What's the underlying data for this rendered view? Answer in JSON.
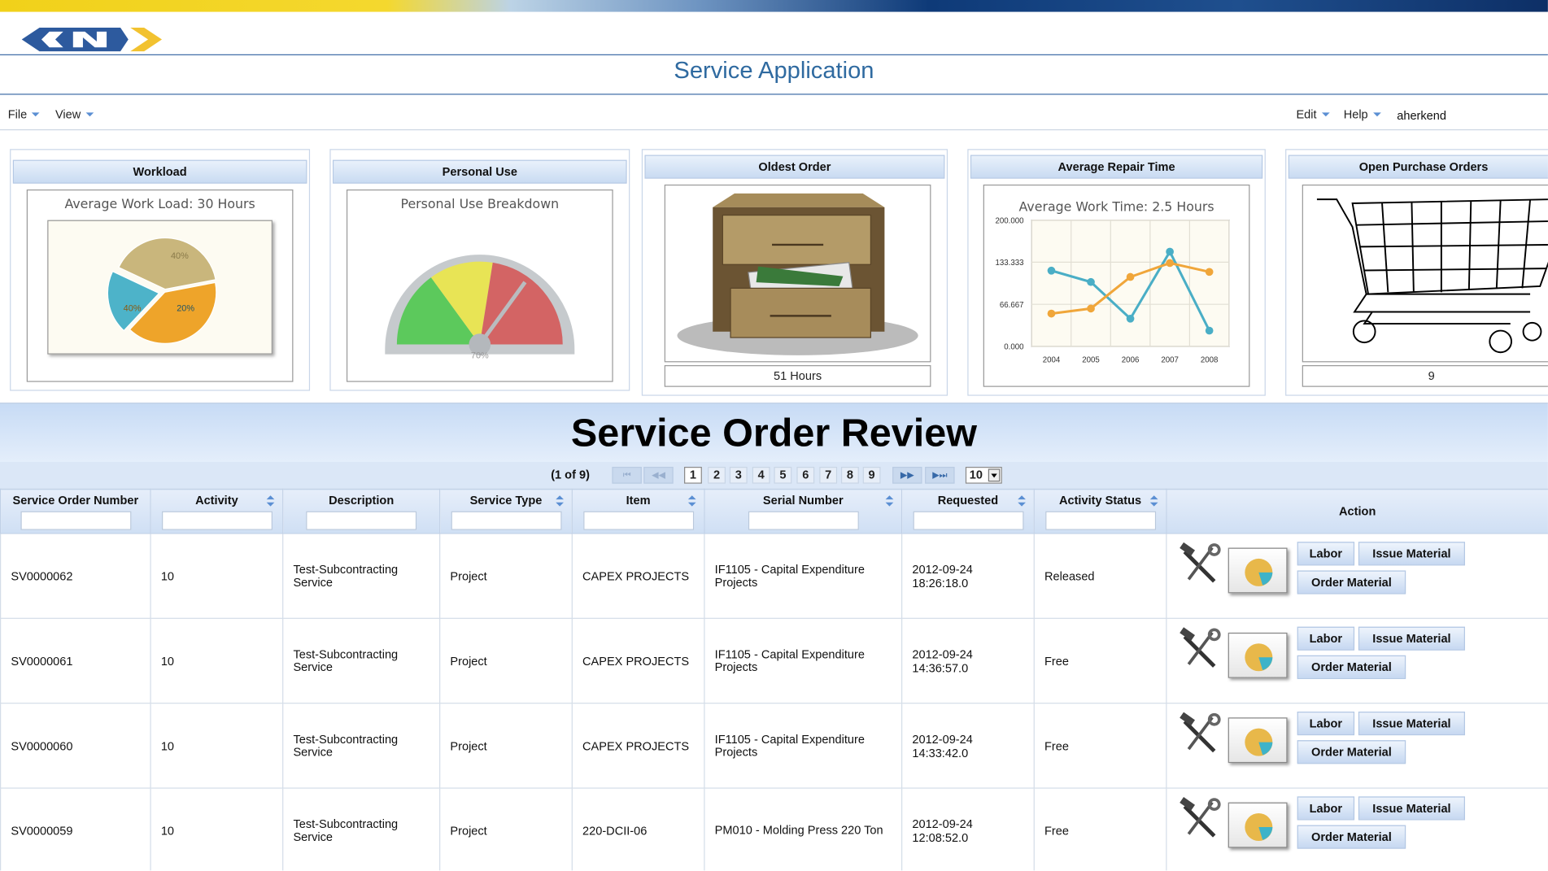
{
  "header": {
    "app_title": "Service Application",
    "logo": "GKN"
  },
  "menubar": {
    "file": "File",
    "view": "View",
    "edit": "Edit",
    "help": "Help",
    "user": "aherkend"
  },
  "widgets": {
    "workload": {
      "title": "Workload",
      "chart_title": "Average Work Load: 30 Hours",
      "labels": [
        "40%",
        "40%",
        "20%"
      ]
    },
    "personal_use": {
      "title": "Personal Use",
      "chart_title": "Personal Use Breakdown",
      "gauge_label": "70%"
    },
    "oldest_order": {
      "title": "Oldest Order",
      "footer": "51 Hours"
    },
    "avg_repair": {
      "title": "Average Repair Time",
      "chart_title": "Average Work Time: 2.5 Hours"
    },
    "open_po": {
      "title": "Open Purchase Orders",
      "footer": "9"
    }
  },
  "chart_data": [
    {
      "type": "pie",
      "title": "Average Work Load: 30 Hours",
      "categories": [
        "",
        "",
        ""
      ],
      "values": [
        40,
        40,
        20
      ],
      "labels": [
        "40%",
        "40%",
        "20%"
      ],
      "colors": [
        "#c9b67c",
        "#eea42a",
        "#4db3c9"
      ]
    },
    {
      "type": "gauge",
      "title": "Personal Use Breakdown",
      "value": 70,
      "range": [
        0,
        100
      ],
      "label": "70%",
      "bands": [
        "#5cc95c",
        "#e8e455",
        "#d36464"
      ]
    },
    {
      "type": "line",
      "title": "Average Work Time: 2.5 Hours",
      "x": [
        "2004",
        "2005",
        "2006",
        "2007",
        "2008"
      ],
      "yticks": [
        "0.000",
        "66.667",
        "133.333",
        "200.000"
      ],
      "ylim": [
        0,
        200
      ],
      "series": [
        {
          "color": "#4aaec6",
          "values": [
            120,
            102,
            44,
            150,
            25
          ]
        },
        {
          "color": "#f0a63a",
          "values": [
            52,
            60,
            110,
            132,
            118
          ]
        }
      ]
    }
  ],
  "banner": {
    "title": "Service Order Review"
  },
  "paginator": {
    "info": "(1 of 9)",
    "pages": [
      "1",
      "2",
      "3",
      "4",
      "5",
      "6",
      "7",
      "8",
      "9"
    ],
    "first": "⏮",
    "prev": "◀◀",
    "next": "▶▶",
    "last": "▶⏭",
    "rows_per_page": "10"
  },
  "table": {
    "columns": [
      "Service Order Number",
      "Activity",
      "Description",
      "Service Type",
      "Item",
      "Serial Number",
      "Requested",
      "Activity Status",
      "Action"
    ],
    "rows": [
      {
        "order": "SV0000062",
        "activity": "10",
        "description": "Test-Subcontracting Service",
        "type": "Project",
        "item": "CAPEX PROJECTS",
        "serial": "IF1105 - Capital Expenditure Projects",
        "requested": "2012-09-24 18:26:18.0",
        "status": "Released"
      },
      {
        "order": "SV0000061",
        "activity": "10",
        "description": "Test-Subcontracting Service",
        "type": "Project",
        "item": "CAPEX PROJECTS",
        "serial": "IF1105 - Capital Expenditure Projects",
        "requested": "2012-09-24 14:36:57.0",
        "status": "Free"
      },
      {
        "order": "SV0000060",
        "activity": "10",
        "description": "Test-Subcontracting Service",
        "type": "Project",
        "item": "CAPEX PROJECTS",
        "serial": "IF1105 - Capital Expenditure Projects",
        "requested": "2012-09-24 14:33:42.0",
        "status": "Free"
      },
      {
        "order": "SV0000059",
        "activity": "10",
        "description": "Test-Subcontracting Service",
        "type": "Project",
        "item": "220-DCII-06",
        "serial": "PM010 - Molding Press 220 Ton",
        "requested": "2012-09-24 12:08:52.0",
        "status": "Free"
      }
    ],
    "actions": {
      "labor": "Labor",
      "issue": "Issue Material",
      "order": "Order Material"
    }
  }
}
